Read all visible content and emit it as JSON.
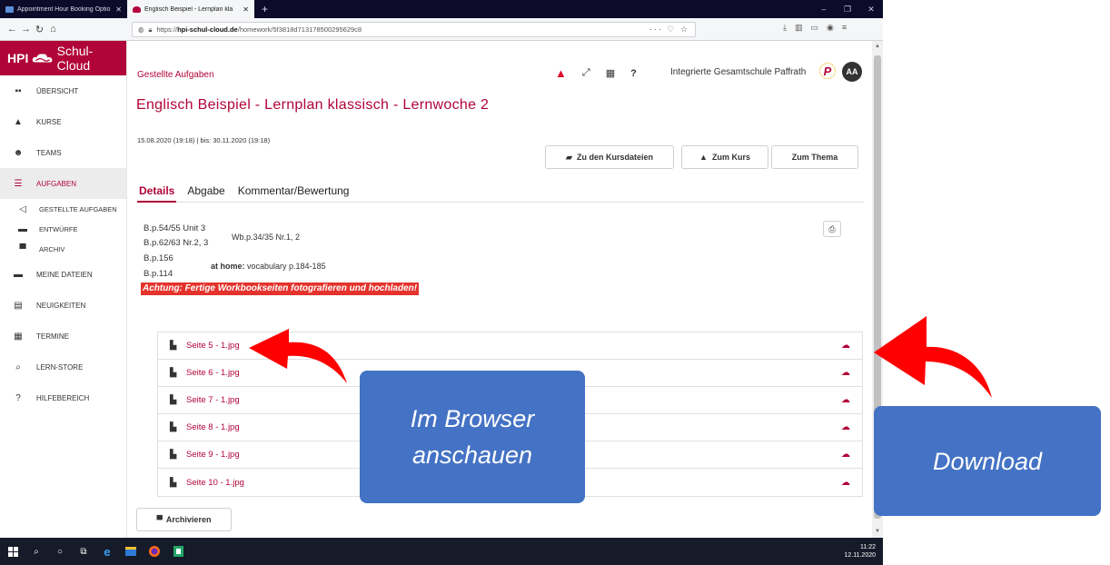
{
  "browser": {
    "tabs": [
      {
        "label": "Appointment Hour Booking Optio",
        "active": false
      },
      {
        "label": "Englisch Beispiel - Lernplan kla",
        "active": true
      }
    ],
    "url_prefix": "https://",
    "url_host": "hpi-schul-cloud.de",
    "url_path": "/homework/5f3818d713178500295629c8",
    "url_actions": "··· ♡ ☆"
  },
  "brand": {
    "hpi": "HPI",
    "name": "Schul-Cloud",
    "color": "#b10438"
  },
  "sidebar": {
    "items": [
      {
        "label": "Übersicht",
        "icon": "dashboard-icon"
      },
      {
        "label": "Kurse",
        "icon": "graduation-cap-icon"
      },
      {
        "label": "Teams",
        "icon": "users-icon"
      },
      {
        "label": "Aufgaben",
        "icon": "tasks-icon",
        "active": true
      },
      {
        "label": "Gestellte Aufgaben",
        "icon": "bullhorn-icon",
        "sub": true
      },
      {
        "label": "Entwürfe",
        "icon": "lock-icon",
        "sub": true
      },
      {
        "label": "Archiv",
        "icon": "archive-icon",
        "sub": true
      },
      {
        "label": "Meine Dateien",
        "icon": "folder-icon"
      },
      {
        "label": "Neuigkeiten",
        "icon": "newspaper-icon"
      },
      {
        "label": "Termine",
        "icon": "calendar-icon"
      },
      {
        "label": "Lern-Store",
        "icon": "search-icon"
      },
      {
        "label": "Hilfebereich",
        "icon": "help-icon"
      }
    ]
  },
  "header": {
    "breadcrumb": "Gestellte Aufgaben",
    "school": "Integrierte Gesamtschule Paffrath",
    "avatar": "AA",
    "school_logo": "P"
  },
  "task": {
    "title": "Englisch Beispiel - Lernplan klassisch - Lernwoche 2",
    "dates": "15.08.2020 (19:18) | bis: 30.11.2020 (19:18)",
    "buttons": {
      "files": "Zu den Kursdateien",
      "course": "Zum Kurs",
      "topic": "Zum Thema"
    },
    "tabs": [
      "Details",
      "Abgabe",
      "Kommentar/Bewertung"
    ],
    "content": {
      "l1": "B.p.54/55 Unit 3",
      "l1b": "Wb.p.34/35 Nr.1, 2",
      "l2": "B.p.62/63 Nr.2, 3",
      "l3": "B.p.156",
      "l4": "B.p.114",
      "home_label": "at home:",
      "home_text": " vocabulary p.184-185",
      "warning": "Achtung: Fertige Workbookseiten fotografieren und hochladen!"
    },
    "files": [
      "Seite 5 - 1.jpg",
      "Seite 6 - 1.jpg",
      "Seite 7 - 1.jpg",
      "Seite 8 - 1.jpg",
      "Seite 9 - 1.jpg",
      "Seite 10 - 1.jpg"
    ],
    "archive_button": "Archivieren"
  },
  "taskbar": {
    "time": "11:22",
    "date": "12.11.2020"
  },
  "annotations": {
    "browser_line1": "Im Browser",
    "browser_line2": "anschauen",
    "download": "Download",
    "callout_color": "#4472c4",
    "arrow_color": "#ff0000"
  }
}
